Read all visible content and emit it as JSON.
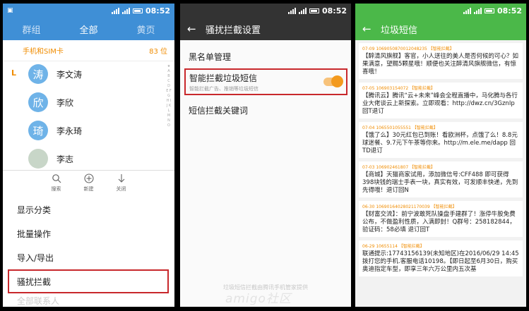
{
  "status": {
    "time": "08:52"
  },
  "panel1": {
    "tabs": [
      "群组",
      "全部",
      "黄页"
    ],
    "active_tab": 1,
    "sim_label": "手机和SIM卡",
    "count": "83 位",
    "section_letter": "L",
    "contacts": [
      {
        "avatar": "涛",
        "name": "李文涛"
      },
      {
        "avatar": "欣",
        "name": "李欣"
      },
      {
        "avatar": "琦",
        "name": "李永琦"
      },
      {
        "avatar": "",
        "name": "李志"
      }
    ],
    "az_index": "★ A B C D E F G H I J K L M N O",
    "sheet_actions": [
      {
        "icon": "search-icon",
        "label": "搜索"
      },
      {
        "icon": "plus-circle-icon",
        "label": "新建"
      },
      {
        "icon": "arrow-down-icon",
        "label": "关闭"
      }
    ],
    "menu": [
      "显示分类",
      "批量操作",
      "导入/导出",
      "骚扰拦截",
      "全部联系人"
    ]
  },
  "panel2": {
    "title": "骚扰拦截设置",
    "items": {
      "blacklist": "黑名单管理",
      "smart_title": "智能拦截垃圾短信",
      "smart_sub": "智能拦截广告、推销等垃圾短信",
      "keywords": "短信拦截关键词"
    },
    "toggle_on": true,
    "footer": "垃圾短信拦截由腾讯手机管家提供",
    "watermark": "amigo社区"
  },
  "panel3": {
    "title": "垃圾短信",
    "messages": [
      {
        "meta": "07-09  1069050870012048235  【智能拦截】",
        "body": "【醉清风旗舰】客官，小人送往的美人是否何候的可心？如果满意，望赐5颗星哦！顺便也关注醉清风旗舰微信，有惊喜哦！"
      },
      {
        "meta": "07-05  106903154072  【智能拦截】",
        "body": "【腾讯云】腾讯“云+未来”峰会全程直播中，马化腾与各行业大佬谈云上新探索。立即观看：http://dwz.cn/3GznIp 回T退订"
      },
      {
        "meta": "07-04  1065501055551  【智能拦截】",
        "body": "【饿了么】30元红包已到账！看欧洲杯，点饿了么！8.8元球迷餐、9.7元下午茶等你来。http://m.ele.me/dapp 回TD退订"
      },
      {
        "meta": "07-03  106902461807  【智能拦截】",
        "body": "【商城】天猫商家试用，添加微信号:CFF488 即可获得398块钱的瑞士手表一块，真实有效，可发顺丰快递，先到先得哦！退订回N"
      },
      {
        "meta": "06-30  10690164028021170039  【智能拦截】",
        "body": "【财富交流】：前宁波敢死队操盘手建群了！涨停牛股免费公布，不做盈利性质，入满即封！Q群号：258182844，验证码：58必填 退订回T"
      },
      {
        "meta": "06-29  10655114  【智能拦截】",
        "body": "联通提示:17743156139(未知地区)在2016/06/29 14:45拨打您的手机.客服电话10198。【即日起至6月30日，购买奥迪指定车型，即享三年六万公里内五次基"
      }
    ]
  }
}
